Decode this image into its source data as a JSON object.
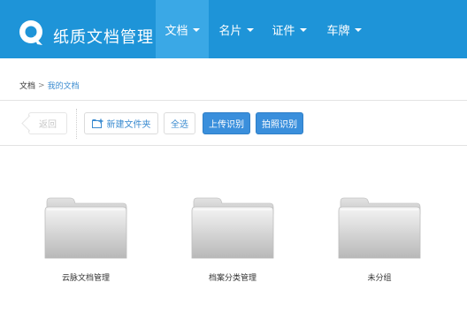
{
  "app": {
    "brand_name": "纸质文档管理",
    "logo_icon": "speech-bubble-q-icon"
  },
  "nav": {
    "items": [
      {
        "label": "文档",
        "active": true
      },
      {
        "label": "名片",
        "active": false
      },
      {
        "label": "证件",
        "active": false
      },
      {
        "label": "车牌",
        "active": false
      }
    ]
  },
  "breadcrumb": {
    "root": "文档",
    "separator": ">",
    "current": "我的文档"
  },
  "toolbar": {
    "back_label": "返回",
    "new_folder_label": "新建文件夹",
    "select_all_label": "全选",
    "upload_label": "上传识别",
    "photo_label": "拍照识别"
  },
  "folders": [
    {
      "name": "云脉文档管理",
      "icon": "folder-icon"
    },
    {
      "name": "档案分类管理",
      "icon": "folder-icon"
    },
    {
      "name": "未分组",
      "icon": "folder-icon"
    }
  ],
  "colors": {
    "nav_bg": "#1e94d8",
    "nav_active": "#3aa8e6",
    "primary_button": "#3a8fdc",
    "link": "#3a8bd0"
  }
}
